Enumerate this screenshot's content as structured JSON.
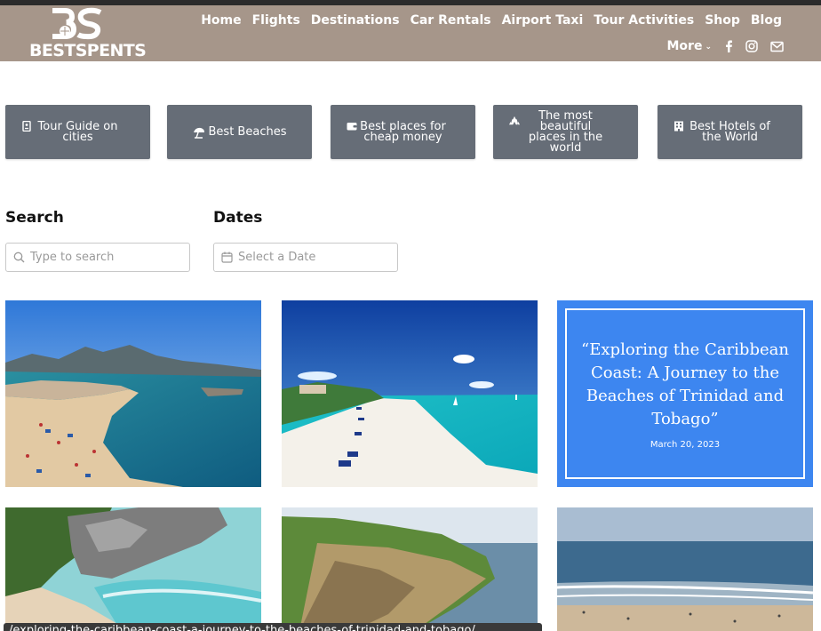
{
  "header": {
    "brand": "BESTSPENTS",
    "nav": [
      "Home",
      "Flights",
      "Destinations",
      "Car Rentals",
      "Airport Taxi",
      "Tour Activities",
      "Shop",
      "Blog"
    ],
    "more_label": "More",
    "social_icons": [
      "facebook-icon",
      "instagram-icon",
      "mail-icon"
    ]
  },
  "categories": [
    {
      "label": "Tour Guide on cities",
      "icon": "guide-icon"
    },
    {
      "label": "Best Beaches",
      "icon": "umbrella-icon"
    },
    {
      "label": "Best places for cheap money",
      "icon": "wallet-icon"
    },
    {
      "label": "The most beautiful places in the world",
      "icon": "landmark-icon"
    },
    {
      "label": "Best Hotels of the World",
      "icon": "hotel-icon"
    }
  ],
  "search": {
    "label": "Search",
    "placeholder": "Type to search"
  },
  "dates": {
    "label": "Dates",
    "placeholder": "Select a Date"
  },
  "featured_post": {
    "title": "“Exploring the Caribbean Coast: A Journey to the Beaches of Trinidad and Tobago”",
    "date": "March 20, 2023"
  },
  "status_tooltip": "/exploring-the-caribbean-coast-a-journey-to-the-beaches-of-trinidad-and-tobago/",
  "colors": {
    "header": "#a6968a",
    "category_button": "#666d77",
    "featured_bg": "#3d86f0"
  }
}
